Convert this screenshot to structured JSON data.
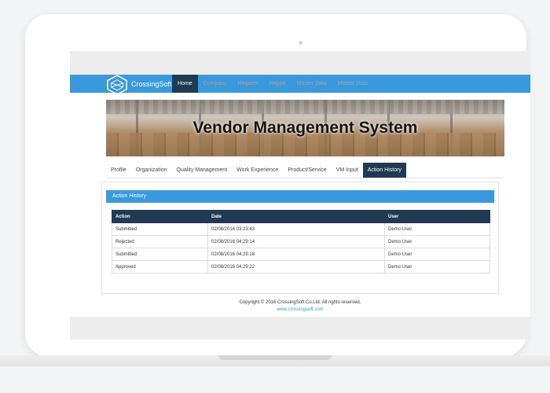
{
  "brand": {
    "name": "CrossingSoft"
  },
  "nav": {
    "items": [
      {
        "label": "Home",
        "active": true
      },
      {
        "label": "Company",
        "active": false
      },
      {
        "label": "Request",
        "active": false
      },
      {
        "label": "Report",
        "active": false
      },
      {
        "label": "Master Data",
        "active": false
      },
      {
        "label": "Master Data",
        "active": false
      }
    ]
  },
  "banner": {
    "title": "Vendor Management System"
  },
  "tabs": [
    {
      "label": "Profile",
      "active": false
    },
    {
      "label": "Organization",
      "active": false
    },
    {
      "label": "Quality Management",
      "active": false
    },
    {
      "label": "Work Experience",
      "active": false
    },
    {
      "label": "Product/Service",
      "active": false
    },
    {
      "label": "VM Input",
      "active": false
    },
    {
      "label": "Action History",
      "active": true
    }
  ],
  "panel": {
    "heading": "Action History",
    "columns": [
      "Action",
      "Date",
      "User"
    ],
    "rows": [
      {
        "action": "Submitted",
        "date": "02/08/2016 03:23:43",
        "user": "Demo User"
      },
      {
        "action": "Rejected",
        "date": "02/08/2016 04:29:14",
        "user": "Demo User"
      },
      {
        "action": "Submitted",
        "date": "02/08/2016 04:29:18",
        "user": "Demo User"
      },
      {
        "action": "Approved",
        "date": "02/08/2016 04:29:22",
        "user": "Demo User"
      }
    ]
  },
  "footer": {
    "copyright": "Copyright © 2016 CrossingSoft Co.Ltd. All rights reserved.",
    "link": "www.crossingsoft.com"
  },
  "colors": {
    "nav_bar": "#3a98dc",
    "active_dark": "#1f3a52"
  },
  "icons": {
    "logo": "hexagon-cube-logo-icon"
  }
}
